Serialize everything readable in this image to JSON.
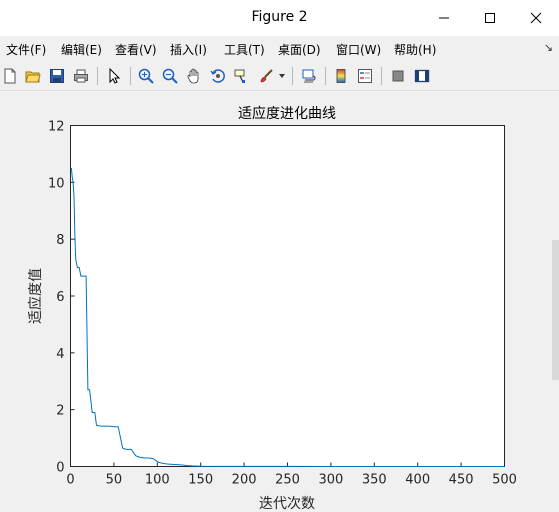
{
  "window": {
    "title": "Figure 2"
  },
  "menu": [
    "文件(F)",
    "编辑(E)",
    "查看(V)",
    "插入(I)",
    "工具(T)",
    "桌面(D)",
    "窗口(W)",
    "帮助(H)"
  ],
  "toolbar_icons": [
    "new-figure-icon",
    "open-file-icon",
    "save-icon",
    "print-icon",
    "edit-plot-arrow-icon",
    "zoom-in-icon",
    "zoom-out-icon",
    "pan-hand-icon",
    "rotate-3d-icon",
    "data-cursor-icon",
    "brush-icon",
    "brush-dropdown-icon",
    "link-plot-icon",
    "colorbar-icon",
    "legend-icon",
    "hide-plot-tools-icon",
    "show-plot-tools-icon"
  ],
  "chart_data": {
    "type": "line",
    "title": "适应度进化曲线",
    "xlabel": "迭代次数",
    "ylabel": "适应度值",
    "xlim": [
      0,
      500
    ],
    "ylim": [
      0,
      12
    ],
    "xticks": [
      0,
      50,
      100,
      150,
      200,
      250,
      300,
      350,
      400,
      450,
      500
    ],
    "yticks": [
      0,
      2,
      4,
      6,
      8,
      10,
      12
    ],
    "grid": false,
    "color": "#0072bd",
    "series": [
      {
        "x": [
          1,
          2,
          3,
          4,
          5,
          6,
          8,
          10,
          12,
          14,
          16,
          18,
          20,
          22,
          25,
          28,
          30,
          35,
          40,
          45,
          50,
          55,
          60,
          62,
          65,
          70,
          75,
          80,
          85,
          90,
          95,
          100,
          105,
          110,
          115,
          120,
          125,
          130,
          135,
          140,
          150,
          175,
          200,
          250,
          300,
          400,
          500
        ],
        "y": [
          10.5,
          10.2,
          10.0,
          9.5,
          8.2,
          7.3,
          7.0,
          7.0,
          6.7,
          6.7,
          6.7,
          6.7,
          2.7,
          2.7,
          1.9,
          1.9,
          1.45,
          1.42,
          1.42,
          1.42,
          1.4,
          1.4,
          0.65,
          0.62,
          0.6,
          0.6,
          0.38,
          0.32,
          0.3,
          0.3,
          0.28,
          0.17,
          0.12,
          0.09,
          0.08,
          0.07,
          0.06,
          0.05,
          0.03,
          0.02,
          0.01,
          0.005,
          0.003,
          0.002,
          0.001,
          0.001,
          0.0
        ]
      }
    ]
  }
}
